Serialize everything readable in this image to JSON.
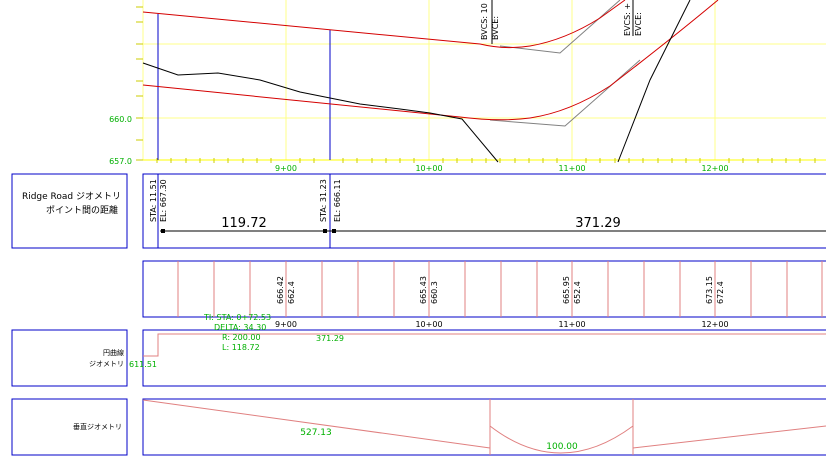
{
  "colors": {
    "background": "#ffffff",
    "frame": "#0000c8",
    "grid": "#ffff88",
    "profile_red": "#d40000",
    "profile_gray": "#808080",
    "ground": "#000000",
    "text_green": "#00b000",
    "text_black": "#000000",
    "band_red": "#e08080"
  },
  "profile": {
    "elev_labels": [
      "660.0",
      "657.0"
    ],
    "station_labels": [
      "9+00",
      "10+00",
      "11+00",
      "12+00"
    ],
    "vertical_curve_labels": [
      "BVCS: 10",
      "BVCE:",
      "EVCS: +",
      "EVCE:"
    ]
  },
  "geometry_band": {
    "title_line1": "Ridge Road ジオメトリ",
    "title_line2": "ポイント間の距離",
    "point1_sta": "STA: 11.51",
    "point1_el": "EL: 667.30",
    "point2_sta": "STA: 31.23",
    "point2_el": "EL: 666.11",
    "distance1": "119.72",
    "distance2": "371.29"
  },
  "elevation_band": {
    "pairs": [
      {
        "top": "666.42",
        "bottom": "662.4"
      },
      {
        "top": "665.43",
        "bottom": "660.3"
      },
      {
        "top": "665.95",
        "bottom": "652.4"
      },
      {
        "top": "673.15",
        "bottom": "672.4"
      }
    ],
    "station_labels": [
      "9+00",
      "10+00",
      "11+00",
      "12+00"
    ]
  },
  "horizontal_band": {
    "title_line1": "円曲線",
    "title_line2": "ジオメトリ",
    "start_value": "611.51",
    "curve_ti_sta": "TI: STA: 0+72.53",
    "curve_delta": "DELTA: 34.30",
    "curve_r": "R: 200.00",
    "curve_l": "L: 118.72",
    "tangent_length": "371.29"
  },
  "vertical_band": {
    "title": "垂直ジオメトリ",
    "grade_length": "527.13",
    "curve_length": "100.00"
  }
}
